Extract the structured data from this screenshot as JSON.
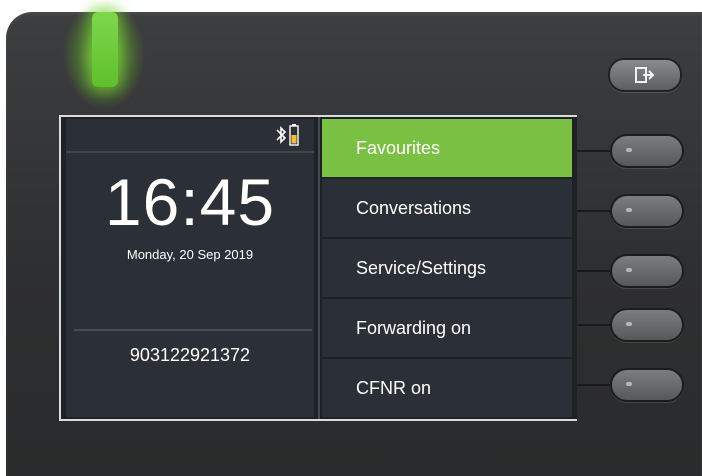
{
  "status": {
    "bluetooth_icon": "bluetooth-icon",
    "battery_icon": "battery-icon",
    "battery_color": "#f0c030"
  },
  "home": {
    "time": "16:45",
    "date": "Monday, 20 Sep 2019",
    "number": "903122921372"
  },
  "menu": {
    "items": [
      {
        "label": "Favourites",
        "selected": true
      },
      {
        "label": "Conversations",
        "selected": false
      },
      {
        "label": "Service/Settings",
        "selected": false
      },
      {
        "label": "Forwarding on",
        "selected": false
      },
      {
        "label": "CFNR on",
        "selected": false
      }
    ]
  },
  "hardware": {
    "led_color": "#6fd23a",
    "exit_icon": "exit-icon",
    "accent": "#7ac143"
  }
}
